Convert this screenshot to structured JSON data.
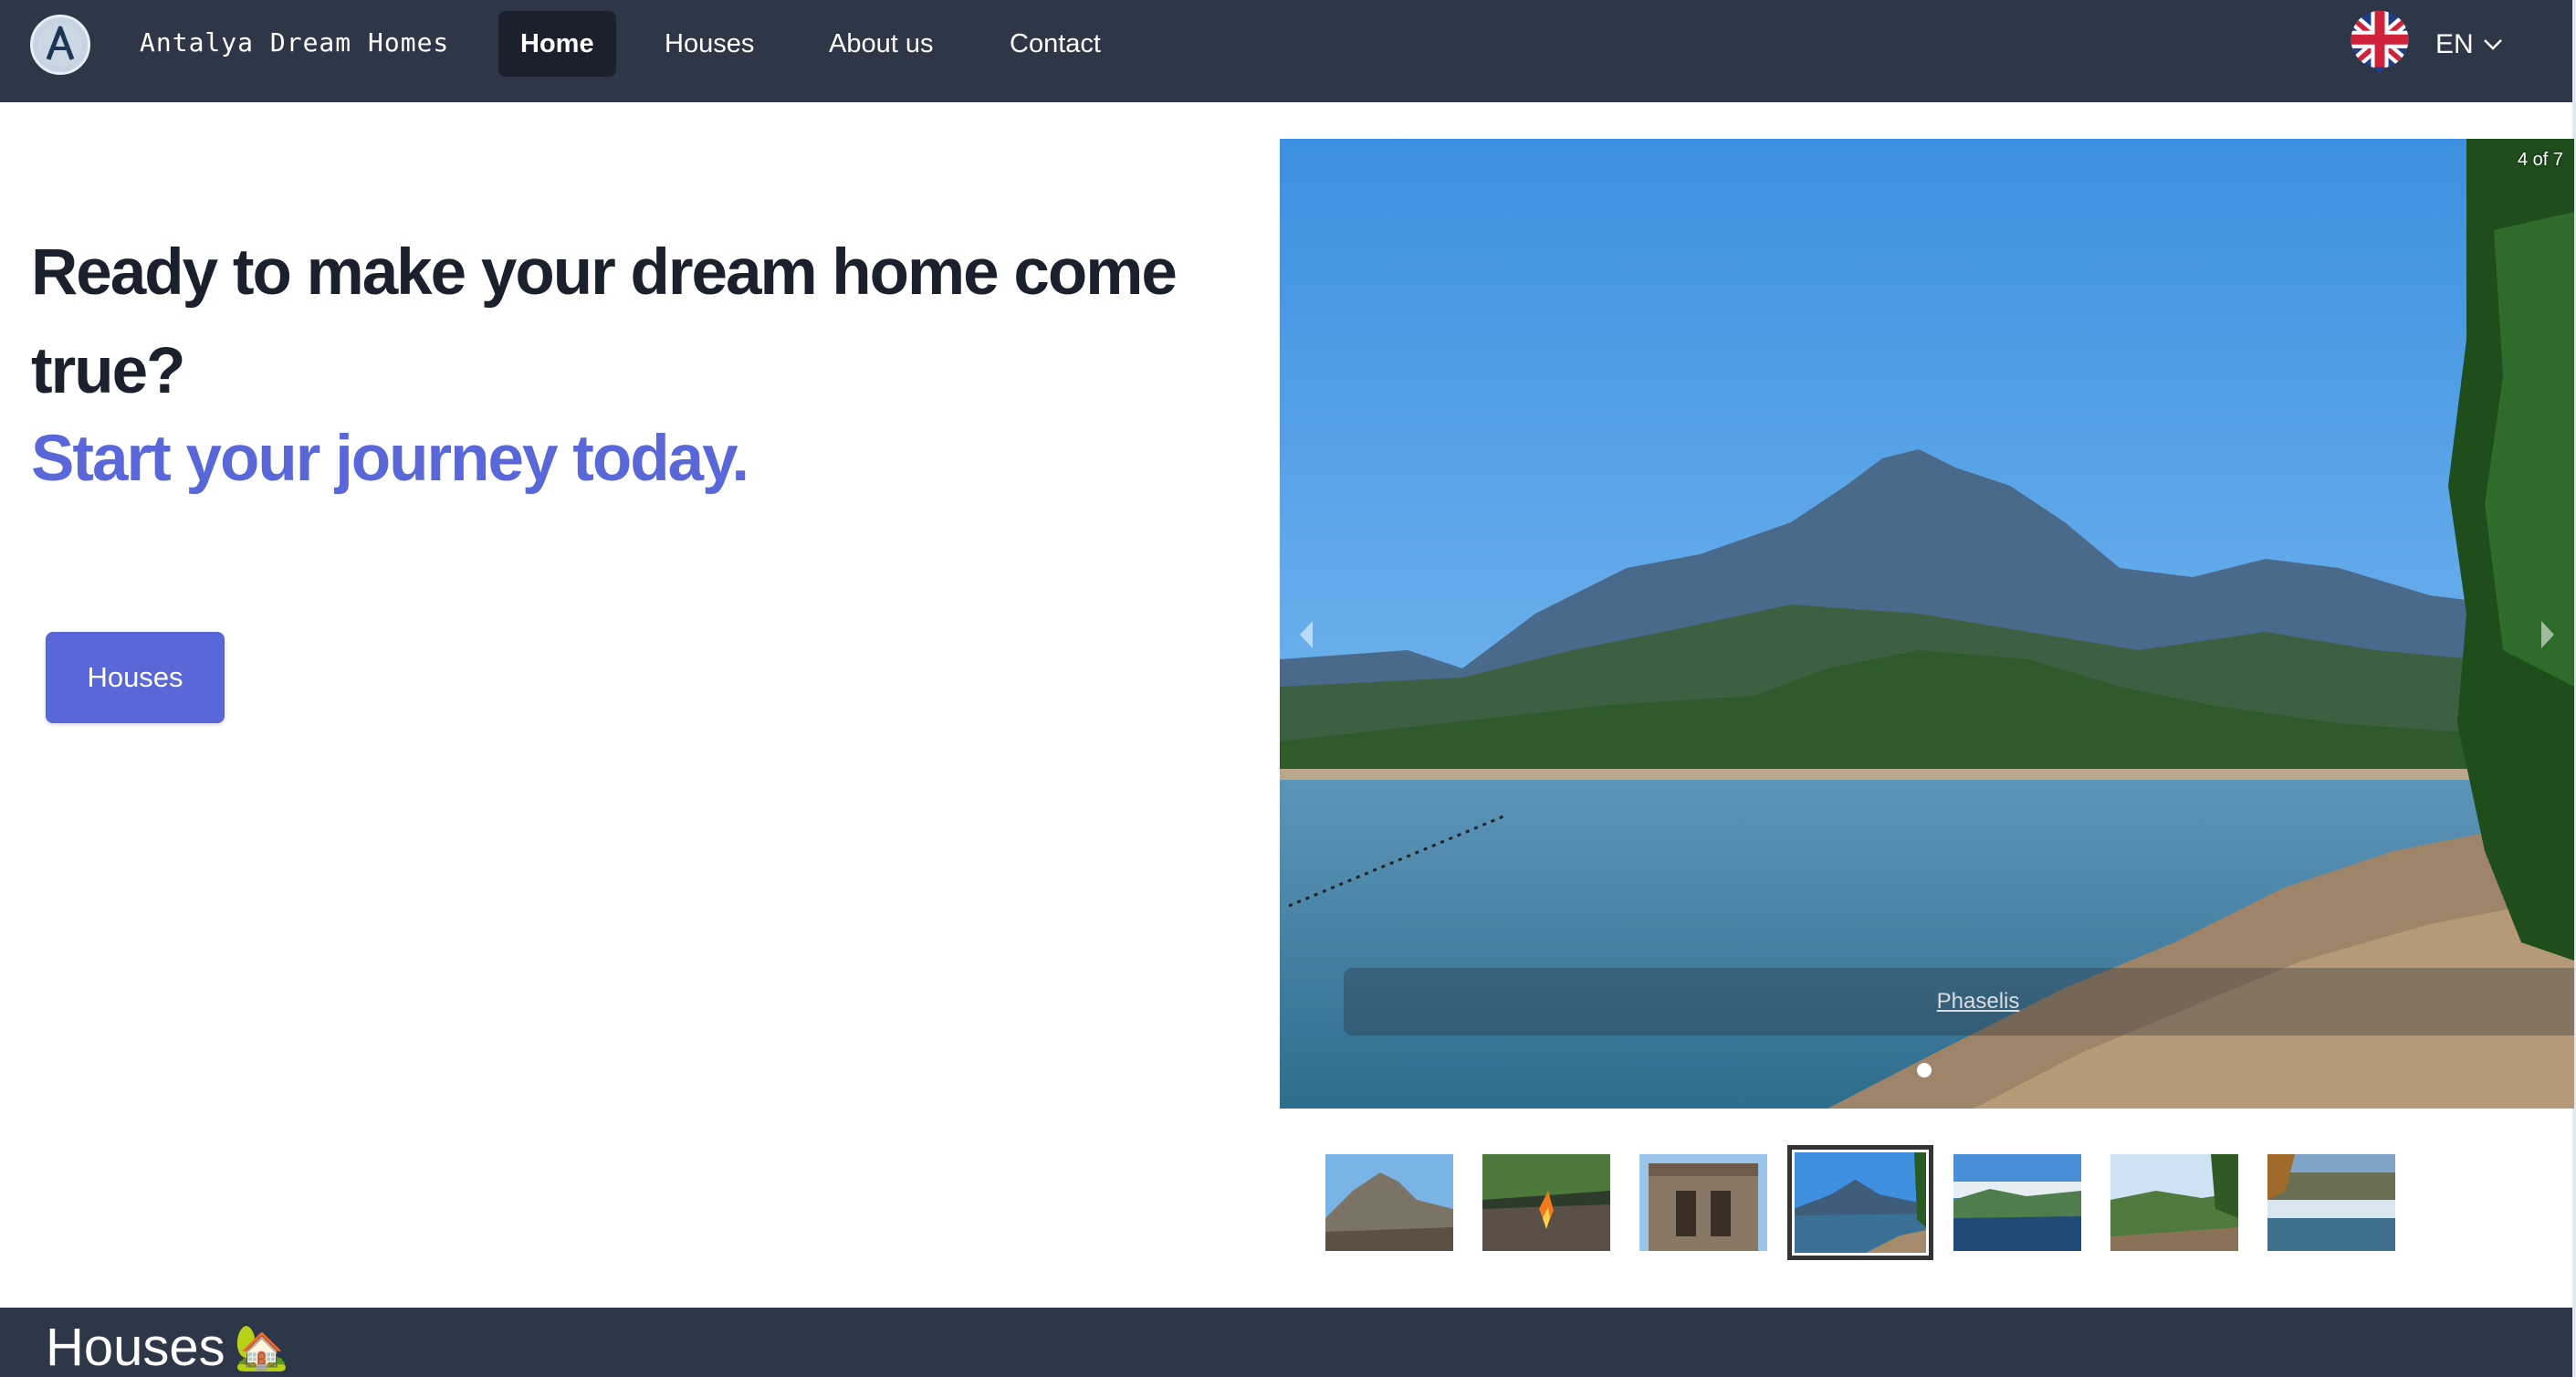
{
  "navbar": {
    "brand": "Antalya Dream Homes",
    "logo_icon": "letter-a-logo-icon",
    "items": [
      {
        "label": "Home",
        "active": true
      },
      {
        "label": "Houses",
        "active": false
      },
      {
        "label": "About us",
        "active": false
      },
      {
        "label": "Contact",
        "active": false
      }
    ],
    "language": {
      "code": "EN",
      "flag_icon": "uk-flag-icon",
      "chevron_icon": "chevron-down-icon"
    },
    "background": "#2d3748",
    "active_background": "#1a202c"
  },
  "hero": {
    "title": "Ready to make your dream home come true?",
    "subtitle": "Start your journey today.",
    "button_label": "Houses",
    "accent_color": "#5a67d8"
  },
  "carousel": {
    "counter": "4 of 7",
    "caption": "Phaselis",
    "current_index": 4,
    "total": 7,
    "prev_icon": "chevron-left-icon",
    "next_icon": "chevron-right-icon",
    "thumbnails": [
      {
        "name": "thumb-1-rocky-ruins"
      },
      {
        "name": "thumb-2-fire"
      },
      {
        "name": "thumb-3-ancient-gate"
      },
      {
        "name": "thumb-4-bay-mountain",
        "selected": true
      },
      {
        "name": "thumb-5-coast-town"
      },
      {
        "name": "thumb-6-green-hills"
      },
      {
        "name": "thumb-7-waterfall"
      }
    ]
  },
  "section": {
    "heading": "Houses",
    "emoji": "🏡"
  }
}
